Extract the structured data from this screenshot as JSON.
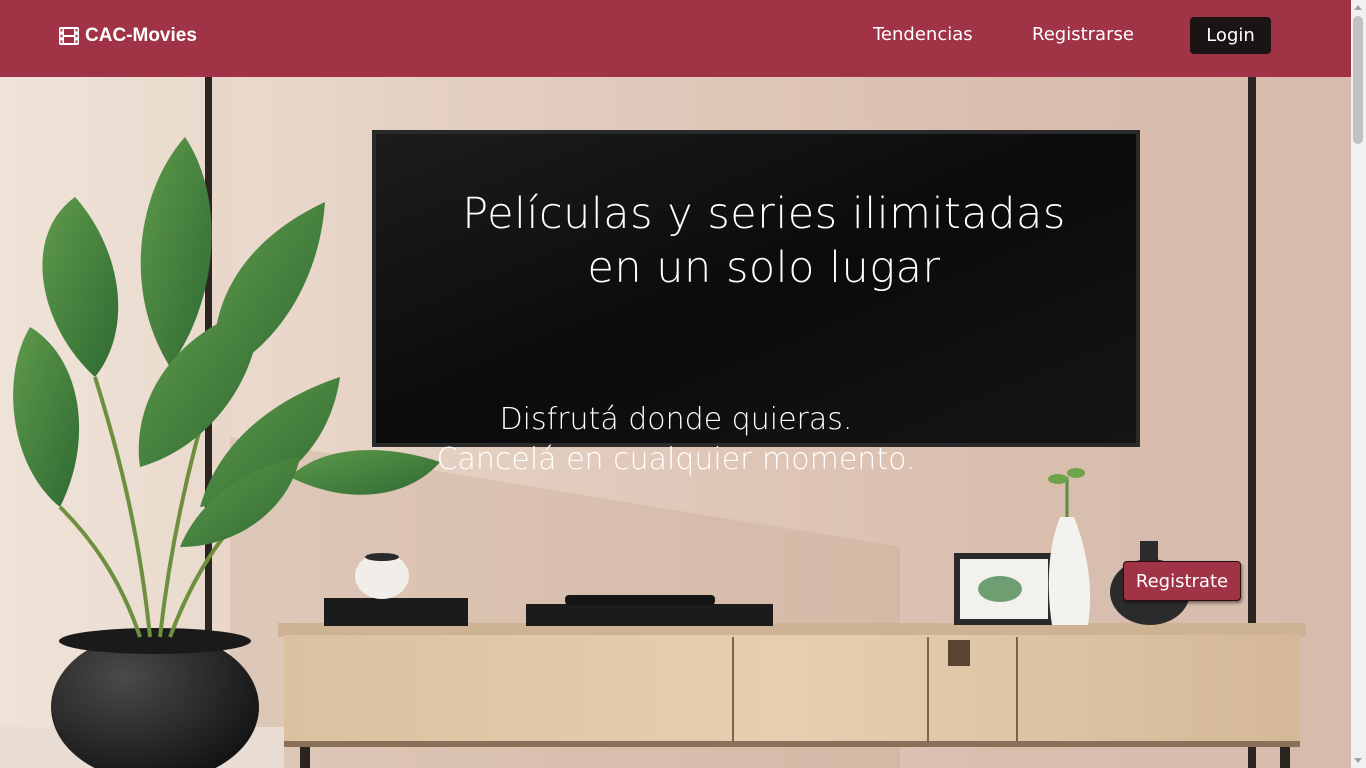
{
  "navbar": {
    "brand": "CAC-Movies",
    "brand_icon": "film-icon",
    "links": [
      "Tendencias",
      "Registrarse"
    ],
    "login_label": "Login",
    "background": "#a03346"
  },
  "hero": {
    "headline_lines": [
      "Películas y series ilimitadas",
      "en un solo lugar"
    ],
    "sub_lines": [
      "Disfrutá donde quieras.",
      "Cancelá en cualquier momento."
    ],
    "cta_label": "Registrate"
  }
}
